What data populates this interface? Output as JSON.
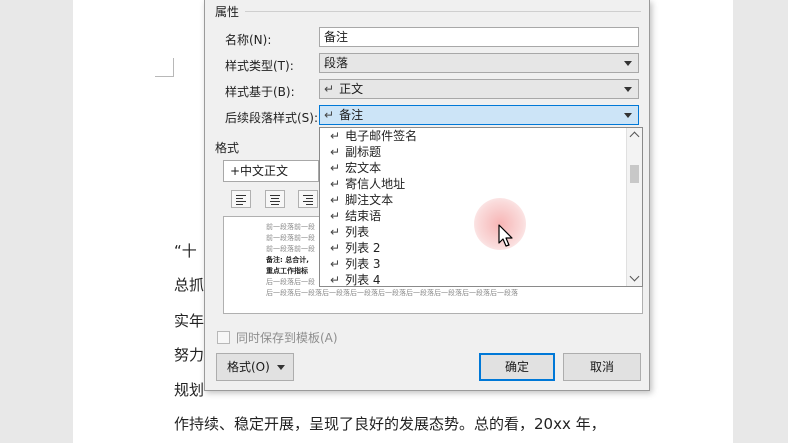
{
  "document": {
    "lines": [
      "“十",
      "总抓",
      "实年",
      "努力",
      "规划",
      "作持续、稳定开展，呈现了良好的发展态势。总的看，20xx 年，"
    ]
  },
  "dialog": {
    "properties_title": "属性",
    "name_label": "名称(N):",
    "name_value": "备注",
    "style_type_label": "样式类型(T):",
    "style_type_value": "段落",
    "based_on_label": "样式基于(B):",
    "based_on_value": "正文",
    "next_style_label": "后续段落样式(S):",
    "next_style_value": "备注",
    "para_mark": "↵",
    "dropdown_items": [
      "电子邮件签名",
      "副标题",
      "宏文本",
      "寄信人地址",
      "脚注文本",
      "结束语",
      "列表",
      "列表 2",
      "列表 3",
      "列表 4"
    ],
    "format_title": "格式",
    "font_value": "+中文正文",
    "preview_lines": [
      "前一段落前一段",
      "前一段落前一段",
      "前一段落前一段",
      "备注: 总合计,",
      "重点工作指标",
      "后一段落后一段",
      "后一段落后一段落后一段落后一段落后一段落后一段落后一段落后一段落后一段落"
    ],
    "save_to_template_label": "同时保存到模板(A)",
    "format_button": "格式(O)",
    "ok_button": "确定",
    "cancel_button": "取消"
  },
  "colors": {
    "accent": "#0078d7",
    "combo_active": "#cce4f7",
    "dialog_bg": "#f0f0f0"
  }
}
